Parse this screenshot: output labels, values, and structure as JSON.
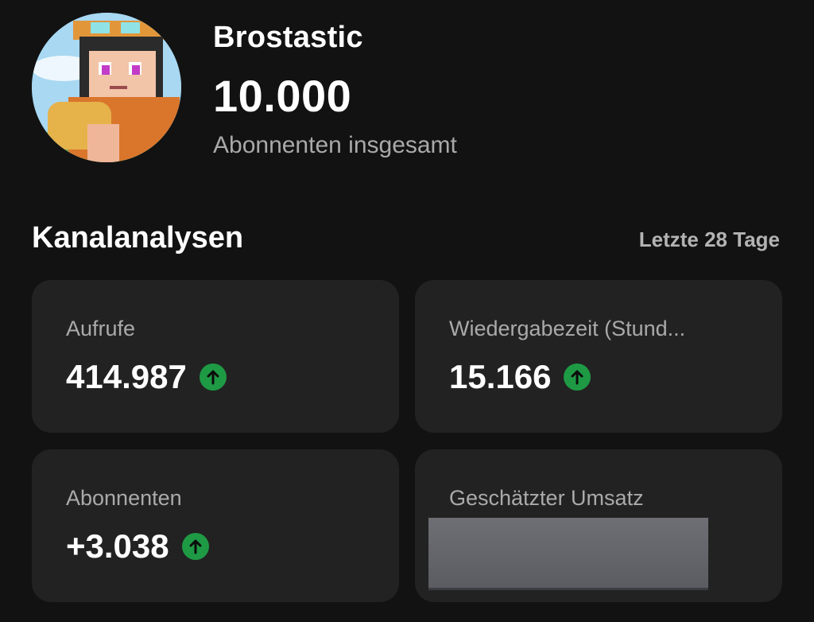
{
  "channel": {
    "name": "Brostastic",
    "subscribers": "10.000",
    "subscribers_label": "Abonnenten insgesamt"
  },
  "analytics": {
    "title": "Kanalanalysen",
    "period": "Letzte 28 Tage",
    "cards": [
      {
        "label": "Aufrufe",
        "value": "414.987",
        "trend": "up"
      },
      {
        "label": "Wiedergabezeit (Stund...",
        "value": "15.166",
        "trend": "up"
      },
      {
        "label": "Abonnenten",
        "value": "+3.038",
        "trend": "up"
      },
      {
        "label": "Geschätzter Umsatz",
        "value": null,
        "redacted": true
      }
    ]
  },
  "colors": {
    "background": "#121212",
    "card": "#222222",
    "trend_up": "#1e9a45",
    "secondary_text": "#aaaaaa"
  },
  "icons": {
    "trend": "arrow-up-circle-icon"
  }
}
